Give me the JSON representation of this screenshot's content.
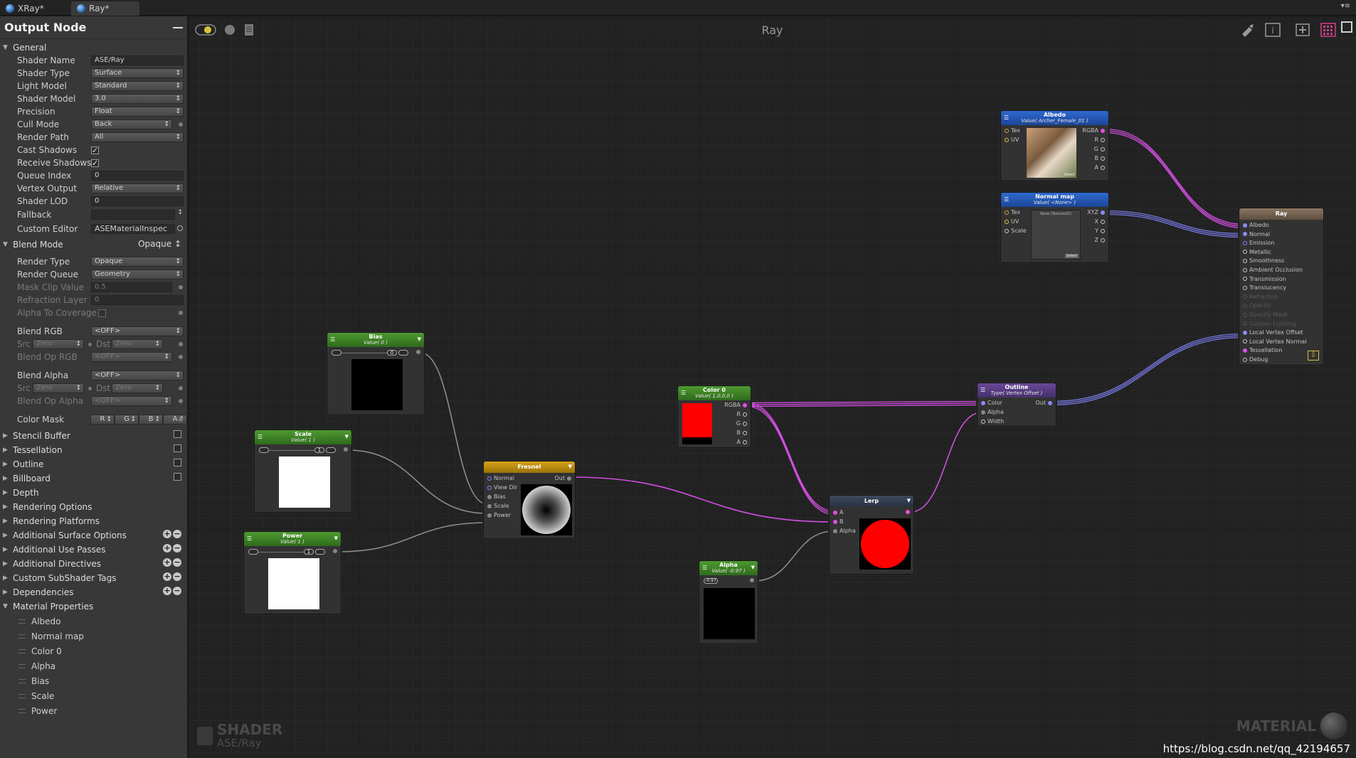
{
  "tabs": [
    {
      "label": "XRay*"
    },
    {
      "label": "Ray*"
    }
  ],
  "sidebar": {
    "title": "Output Node",
    "general": {
      "label": "General",
      "shader_name": {
        "label": "Shader Name",
        "value": "ASE/Ray"
      },
      "shader_type": {
        "label": "Shader Type",
        "value": "Surface"
      },
      "light_model": {
        "label": "Light Model",
        "value": "Standard"
      },
      "shader_model": {
        "label": "Shader Model",
        "value": "3.0"
      },
      "precision": {
        "label": "Precision",
        "value": "Float"
      },
      "cull_mode": {
        "label": "Cull Mode",
        "value": "Back"
      },
      "render_path": {
        "label": "Render Path",
        "value": "All"
      },
      "cast_shadows": {
        "label": "Cast Shadows",
        "checked": true
      },
      "receive_shadows": {
        "label": "Receive Shadows",
        "checked": true
      },
      "queue_index": {
        "label": "Queue Index",
        "value": "0"
      },
      "vertex_output": {
        "label": "Vertex Output",
        "value": "Relative"
      },
      "shader_lod": {
        "label": "Shader LOD",
        "value": "0"
      },
      "fallback": {
        "label": "Fallback",
        "value": ""
      },
      "custom_editor": {
        "label": "Custom Editor",
        "value": "ASEMaterialInspec"
      }
    },
    "blend_mode": {
      "label": "Blend Mode",
      "value": "Opaque",
      "render_type": {
        "label": "Render Type",
        "value": "Opaque"
      },
      "render_queue": {
        "label": "Render Queue",
        "value": "Geometry"
      },
      "mask_clip": {
        "label": "Mask Clip Value",
        "value": "0.5"
      },
      "refraction_layer": {
        "label": "Refraction Layer",
        "value": "0"
      },
      "alpha_to_coverage": {
        "label": "Alpha To Coverage"
      },
      "blend_rgb": {
        "label": "Blend RGB",
        "value": "<OFF>"
      },
      "src_rgb": {
        "label": "Src",
        "value": "Zero"
      },
      "dst_rgb": {
        "label": "Dst",
        "value": "Zero"
      },
      "blend_op_rgb": {
        "label": "Blend Op RGB",
        "value": "<OFF>"
      },
      "blend_alpha": {
        "label": "Blend Alpha",
        "value": "<OFF>"
      },
      "src_alpha": {
        "label": "Src",
        "value": "Zero"
      },
      "dst_alpha": {
        "label": "Dst",
        "value": "Zero"
      },
      "blend_op_alpha": {
        "label": "Blend Op Alpha",
        "value": "<OFF>"
      },
      "color_mask": {
        "label": "Color Mask",
        "channels": [
          "R",
          "G",
          "B",
          "A"
        ]
      }
    },
    "sections": [
      {
        "label": "Stencil Buffer",
        "tail": "checkbox"
      },
      {
        "label": "Tessellation",
        "tail": "checkbox"
      },
      {
        "label": "Outline",
        "tail": "checkbox"
      },
      {
        "label": "Billboard",
        "tail": "checkbox"
      },
      {
        "label": "Depth",
        "tail": ""
      },
      {
        "label": "Rendering Options",
        "tail": ""
      },
      {
        "label": "Rendering Platforms",
        "tail": ""
      },
      {
        "label": "Additional Surface Options",
        "tail": "plusminus"
      },
      {
        "label": "Additional Use Passes",
        "tail": "plusminus"
      },
      {
        "label": "Additional Directives",
        "tail": "plusminus"
      },
      {
        "label": "Custom SubShader Tags",
        "tail": "plusminus"
      },
      {
        "label": "Dependencies",
        "tail": "plusminus"
      }
    ],
    "material_properties": {
      "label": "Material Properties",
      "items": [
        "Albedo",
        "Normal map",
        "Color 0",
        "Alpha",
        "Bias",
        "Scale",
        "Power"
      ]
    }
  },
  "canvas": {
    "title": "Ray",
    "watermark_left": "SHADER",
    "watermark_left_sub": "ASE/Ray",
    "watermark_right": "MATERIAL",
    "url": "https://blog.csdn.net/qq_42194657"
  },
  "nodes": {
    "bias": {
      "title": "Bias",
      "subtitle": "Value( 0 )",
      "slider": "0"
    },
    "scale": {
      "title": "Scale",
      "subtitle": "Value( 1 )",
      "slider": "1"
    },
    "power": {
      "title": "Power",
      "subtitle": "Value( 1 )",
      "slider": "1"
    },
    "fresnel": {
      "title": "Fresnel",
      "inputs": [
        "Normal",
        "View Dir",
        "Bias",
        "Scale",
        "Power"
      ],
      "output": "Out"
    },
    "color0": {
      "title": "Color 0",
      "subtitle": "Value( 1,0,0,0 )",
      "outputs": [
        "RGBA",
        "R",
        "G",
        "B",
        "A"
      ]
    },
    "alpha": {
      "title": "Alpha",
      "subtitle": "Value( -0.97 )",
      "slider": "-0.97"
    },
    "lerp": {
      "title": "Lerp",
      "inputs": [
        "A",
        "B",
        "Alpha"
      ]
    },
    "outline": {
      "title": "Outline",
      "subtitle": "Type( Vertex Offset )",
      "inputs": [
        "Color",
        "Alpha",
        "Width"
      ],
      "output": "Out"
    },
    "albedo": {
      "title": "Albedo",
      "subtitle": "Value( Archer_Female_01 )",
      "inputs": [
        "Tex",
        "UV"
      ],
      "outputs": [
        "RGBA",
        "R",
        "G",
        "B",
        "A"
      ],
      "select": "Select"
    },
    "normal": {
      "title": "Normal map",
      "subtitle": "Value( <None> )",
      "inputs": [
        "Tex",
        "UV",
        "Scale"
      ],
      "outputs": [
        "XYZ",
        "X",
        "Y",
        "Z"
      ],
      "texture_label": "None (Texture2D)",
      "select": "Select"
    },
    "ray": {
      "title": "Ray",
      "inputs": [
        "Albedo",
        "Normal",
        "Emission",
        "Metallic",
        "Smoothness",
        "Ambient Occlusion",
        "Transmission",
        "Translucency",
        "Refraction",
        "Opacity",
        "Opacity Mask",
        "Custom Lighting",
        "Local Vertex Offset",
        "Local Vertex Normal",
        "Tessellation",
        "Debug"
      ]
    }
  },
  "colors": {
    "wire_magenta": "#d24ee0",
    "wire_blue": "#7a7ae8",
    "wire_gray": "#8c8c8c",
    "color0_swatch": "#ff0000"
  }
}
